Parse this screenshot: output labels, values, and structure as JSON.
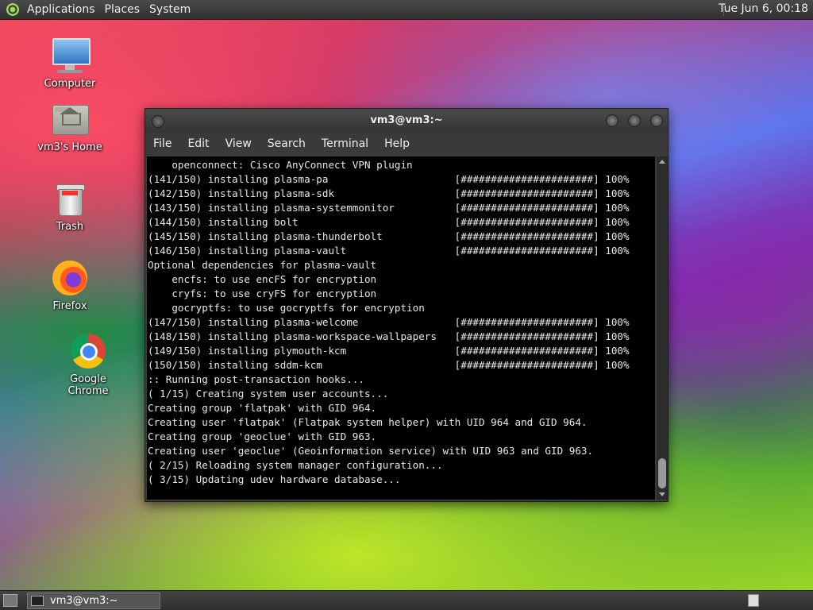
{
  "top_panel": {
    "menus": [
      "Applications",
      "Places",
      "System"
    ],
    "clock": "Tue Jun  6, 00:18"
  },
  "desktop_icons": [
    {
      "label": "Computer",
      "icon": "computer-icon"
    },
    {
      "label": "vm3's Home",
      "icon": "home-folder-icon"
    },
    {
      "label": "Trash",
      "icon": "trash-icon"
    },
    {
      "label": "Firefox",
      "icon": "firefox-icon"
    },
    {
      "label": "Google Chrome",
      "icon": "chrome-icon"
    }
  ],
  "terminal": {
    "title": "vm3@vm3:~",
    "menus": [
      "File",
      "Edit",
      "View",
      "Search",
      "Terminal",
      "Help"
    ],
    "lines": [
      "    openconnect: Cisco AnyConnect VPN plugin",
      "(141/150) installing plasma-pa                     [######################] 100%",
      "(142/150) installing plasma-sdk                    [######################] 100%",
      "(143/150) installing plasma-systemmonitor          [######################] 100%",
      "(144/150) installing bolt                          [######################] 100%",
      "(145/150) installing plasma-thunderbolt            [######################] 100%",
      "(146/150) installing plasma-vault                  [######################] 100%",
      "Optional dependencies for plasma-vault",
      "    encfs: to use encFS for encryption",
      "    cryfs: to use cryFS for encryption",
      "    gocryptfs: to use gocryptfs for encryption",
      "(147/150) installing plasma-welcome                [######################] 100%",
      "(148/150) installing plasma-workspace-wallpapers   [######################] 100%",
      "(149/150) installing plymouth-kcm                  [######################] 100%",
      "(150/150) installing sddm-kcm                      [######################] 100%",
      ":: Running post-transaction hooks...",
      "( 1/15) Creating system user accounts...",
      "Creating group 'flatpak' with GID 964.",
      "Creating user 'flatpak' (Flatpak system helper) with UID 964 and GID 964.",
      "Creating group 'geoclue' with GID 963.",
      "Creating user 'geoclue' (Geoinformation service) with UID 963 and GID 963.",
      "( 2/15) Reloading system manager configuration...",
      "( 3/15) Updating udev hardware database..."
    ]
  },
  "taskbar": {
    "task_label": "vm3@vm3:~"
  }
}
